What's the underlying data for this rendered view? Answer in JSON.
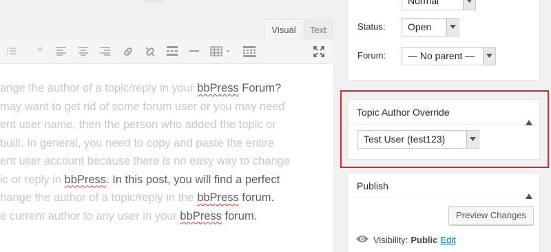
{
  "editor": {
    "tabs": {
      "visual": "Visual",
      "text": "Text"
    },
    "toolbar_icons": [
      "list-icon",
      "quote-icon",
      "align-left-icon",
      "align-center-icon",
      "align-right-icon",
      "link-icon",
      "unlink-icon",
      "read-more-icon",
      "horizontal-line-icon",
      "table-icon",
      "toolbar-toggle-icon",
      "fullscreen-icon"
    ],
    "lines": [
      [
        "ange the author of a topic/reply in your ",
        "bbPress",
        " Forum?"
      ],
      [
        "may want to get rid of some forum user or you may need",
        "",
        ""
      ],
      [
        "ent user name, then the person who added the topic or",
        "",
        ""
      ],
      [
        "built. In general, you need to copy and paste the entire",
        "",
        ""
      ],
      [
        "ent user account because there is no easy way to change",
        "",
        ""
      ],
      [
        "ic or reply in ",
        "bbPress",
        ". In this post, you will find a perfect"
      ],
      [
        "hange the author of a topic/reply in the ",
        "bbPress",
        " forum."
      ],
      [
        "e current author to any user in your ",
        "bbPress",
        " forum."
      ]
    ]
  },
  "sidebar": {
    "type_value": "Normal",
    "status_label": "Status:",
    "status_value": "Open",
    "forum_label": "Forum:",
    "forum_value": "— No parent —"
  },
  "author_override": {
    "title": "Topic Author Override",
    "selected_user": "Test User (test123)"
  },
  "publish": {
    "title": "Publish",
    "preview_button": "Preview Changes",
    "visibility_label": "Visibility:",
    "visibility_value": "Public",
    "edit_link": "Edit"
  },
  "colors": {
    "highlight": "#e32229",
    "link": "#0073aa"
  }
}
